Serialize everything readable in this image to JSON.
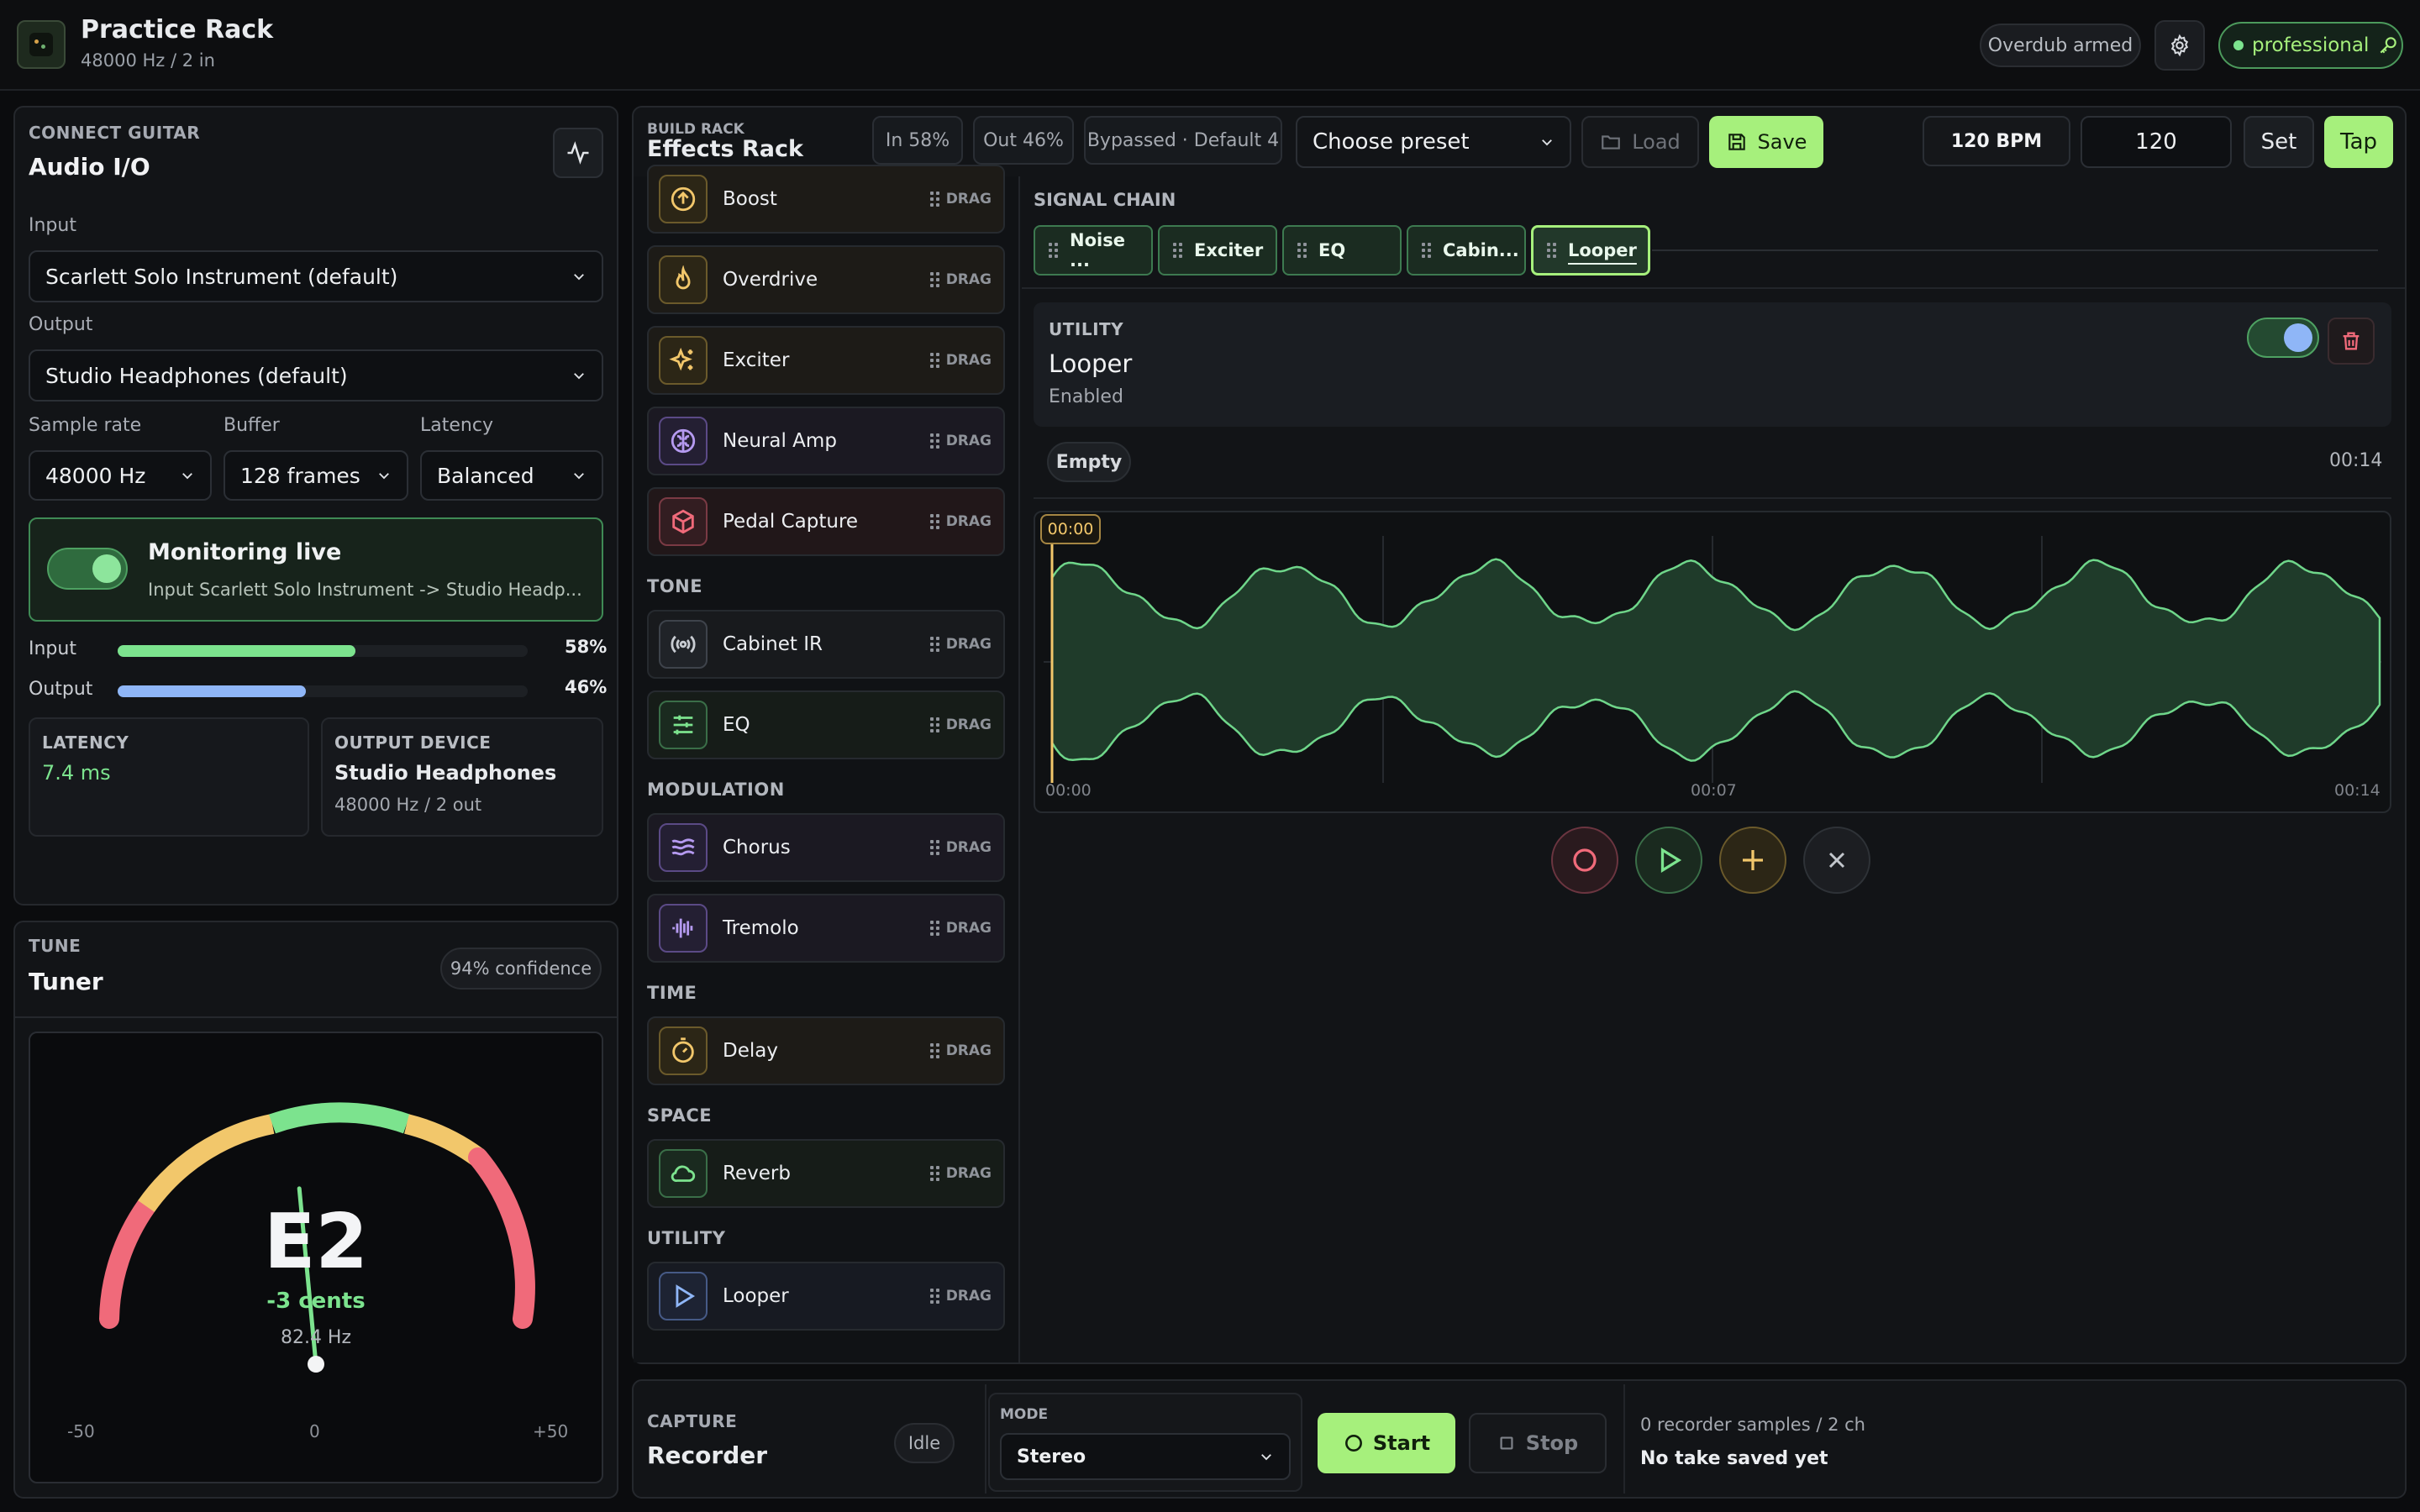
{
  "header": {
    "title": "Practice Rack",
    "subtitle": "48000 Hz / 2 in",
    "overdub_badge": "Overdub armed",
    "user_badge": "professional"
  },
  "audio_io": {
    "caption": "CONNECT GUITAR",
    "title": "Audio I/O",
    "input_label": "Input",
    "input_value": "Scarlett Solo Instrument (default)",
    "output_label": "Output",
    "output_value": "Studio Headphones (default)",
    "sample_rate_label": "Sample rate",
    "sample_rate_value": "48000 Hz",
    "buffer_label": "Buffer",
    "buffer_value": "128 frames",
    "latency_label": "Latency",
    "latency_value": "Balanced",
    "monitor_title": "Monitoring live",
    "monitor_desc": "Input Scarlett Solo Instrument -> Studio Headp...",
    "meter_input_label": "Input",
    "meter_input_value": "58%",
    "meter_input_level": 0.58,
    "meter_output_label": "Output",
    "meter_output_value": "46%",
    "meter_output_level": 0.46,
    "latency_card_caption": "LATENCY",
    "latency_card_value": "7.4 ms",
    "device_card_caption": "OUTPUT DEVICE",
    "device_card_name": "Studio Headphones",
    "device_card_detail": "48000 Hz / 2 out"
  },
  "tuner": {
    "caption": "TUNE",
    "title": "Tuner",
    "confidence": "94% confidence",
    "note": "E2",
    "cents": "-3 cents",
    "frequency": "82.4 Hz",
    "scale_min": "-50",
    "scale_mid": "0",
    "scale_max": "+50",
    "cents_value": -3
  },
  "rack": {
    "caption": "BUILD RACK",
    "title": "Effects Rack",
    "in_level": "In 58%",
    "out_level": "Out 46%",
    "bypassed": "Bypassed · Default 4",
    "preset_placeholder": "Choose preset",
    "load_label": "Load",
    "save_label": "Save",
    "bpm_label": "120 BPM",
    "bpm_input": "120",
    "set_label": "Set",
    "tap_label": "Tap",
    "drag_label": "DRAG",
    "sections": {
      "tone": "TONE",
      "modulation": "MODULATION",
      "time": "TIME",
      "space": "SPACE",
      "utility": "UTILITY"
    },
    "effects": {
      "boost": "Boost",
      "overdrive": "Overdrive",
      "exciter": "Exciter",
      "neural_amp": "Neural Amp",
      "pedal_capture": "Pedal Capture",
      "cabinet_ir": "Cabinet IR",
      "eq": "EQ",
      "chorus": "Chorus",
      "tremolo": "Tremolo",
      "delay": "Delay",
      "reverb": "Reverb",
      "looper": "Looper"
    }
  },
  "chain": {
    "caption": "SIGNAL CHAIN",
    "items": [
      "Noise ...",
      "Exciter",
      "EQ",
      "Cabin...",
      "Looper"
    ]
  },
  "looper": {
    "caption": "UTILITY",
    "title": "Looper",
    "status": "Enabled",
    "state_badge": "Empty",
    "length": "00:14",
    "playhead": "00:00",
    "axis": [
      "00:00",
      "00:07",
      "00:14"
    ]
  },
  "recorder": {
    "caption": "CAPTURE",
    "title": "Recorder",
    "state": "Idle",
    "mode_caption": "MODE",
    "mode_value": "Stereo",
    "start_label": "Start",
    "stop_label": "Stop",
    "samples": "0 recorder samples / 2 ch",
    "take_status": "No take saved yet"
  },
  "colors": {
    "accent": "#a6f07c",
    "green": "#6fe08a",
    "blue": "#8fb6f7",
    "red": "#f06a7a",
    "amber": "#f2c76b"
  }
}
